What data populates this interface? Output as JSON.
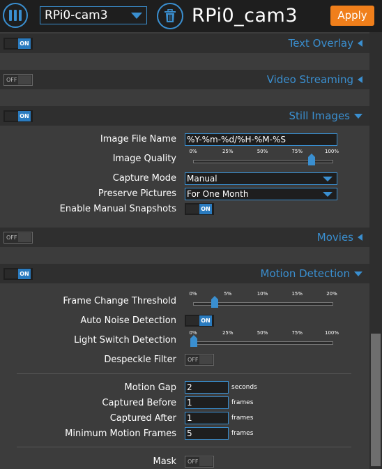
{
  "header": {
    "camera_selected": "RPi0-cam3",
    "camera_title": "RPi0_cam3",
    "apply_label": "Apply"
  },
  "sections": {
    "text_overlay": {
      "title": "Text Overlay",
      "toggle": "ON"
    },
    "video_streaming": {
      "title": "Video Streaming",
      "toggle": "OFF"
    },
    "still_images": {
      "title": "Still Images",
      "toggle": "ON"
    },
    "movies": {
      "title": "Movies",
      "toggle": "OFF"
    },
    "motion_detection": {
      "title": "Motion Detection",
      "toggle": "ON"
    }
  },
  "still_images": {
    "file_name_label": "Image File Name",
    "file_name_value": "%Y-%m-%d/%H-%M-%S",
    "quality_label": "Image Quality",
    "quality_ticks": [
      "0%",
      "25%",
      "50%",
      "75%",
      "100%"
    ],
    "quality_value_percent": 85,
    "capture_mode_label": "Capture Mode",
    "capture_mode_value": "Manual",
    "preserve_label": "Preserve Pictures",
    "preserve_value": "For One Month",
    "manual_snapshots_label": "Enable Manual Snapshots",
    "manual_snapshots_toggle": "ON"
  },
  "motion": {
    "threshold_label": "Frame Change Threshold",
    "threshold_ticks": [
      "0%",
      "5%",
      "10%",
      "15%",
      "20%"
    ],
    "threshold_value_percent": 3,
    "auto_noise_label": "Auto Noise Detection",
    "auto_noise_toggle": "ON",
    "light_switch_label": "Light Switch Detection",
    "light_switch_ticks": [
      "0%",
      "25%",
      "50%",
      "75%",
      "100%"
    ],
    "light_switch_value_percent": 0,
    "despeckle_label": "Despeckle Filter",
    "despeckle_toggle": "OFF",
    "motion_gap_label": "Motion Gap",
    "motion_gap_value": "2",
    "motion_gap_unit": "seconds",
    "captured_before_label": "Captured Before",
    "captured_before_value": "1",
    "captured_before_unit": "frames",
    "captured_after_label": "Captured After",
    "captured_after_value": "1",
    "captured_after_unit": "frames",
    "min_frames_label": "Minimum Motion Frames",
    "min_frames_value": "5",
    "min_frames_unit": "frames",
    "mask_label": "Mask",
    "mask_toggle": "OFF"
  },
  "colors": {
    "accent": "#3a8fd0",
    "apply": "#f07f1b",
    "toggle_on": "#2a7bbf"
  }
}
